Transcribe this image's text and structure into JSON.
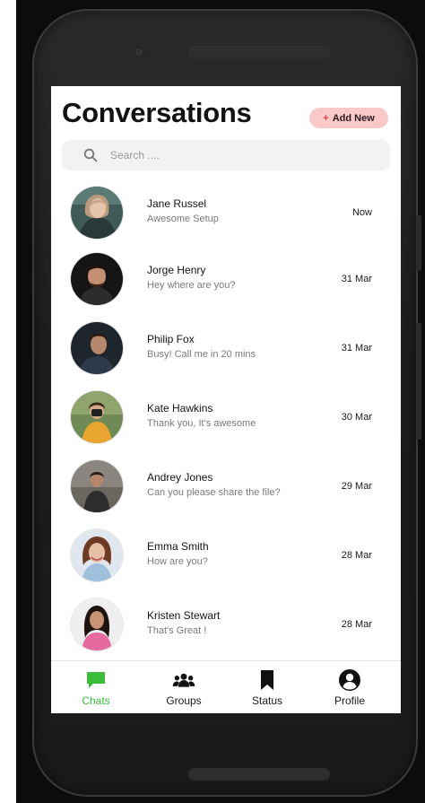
{
  "header": {
    "title": "Conversations",
    "add_button": {
      "icon": "+",
      "label": "Add New"
    }
  },
  "search": {
    "placeholder": "Search ...."
  },
  "conversations": [
    {
      "name": "Jane Russel",
      "message": "Awesome Setup",
      "time": "Now"
    },
    {
      "name": "Jorge Henry",
      "message": "Hey where are you?",
      "time": "31 Mar"
    },
    {
      "name": "Philip Fox",
      "message": "Busy! Call me in 20 mins",
      "time": "31 Mar"
    },
    {
      "name": "Kate Hawkins",
      "message": "Thank you, It's awesome",
      "time": "30 Mar"
    },
    {
      "name": "Andrey Jones",
      "message": "Can you please share the file?",
      "time": "29 Mar"
    },
    {
      "name": "Emma Smith",
      "message": "How are you?",
      "time": "28 Mar"
    },
    {
      "name": "Kristen Stewart",
      "message": "That's Great !",
      "time": "28 Mar"
    }
  ],
  "tabs": [
    {
      "label": "Chats",
      "icon": "chat-bubble-icon",
      "active": true
    },
    {
      "label": "Groups",
      "icon": "groups-icon",
      "active": false
    },
    {
      "label": "Status",
      "icon": "bookmark-icon",
      "active": false
    },
    {
      "label": "Profile",
      "icon": "profile-icon",
      "active": false
    }
  ],
  "colors": {
    "accent": "#3bbd3b",
    "add_button_bg": "#f9c9c9",
    "add_button_plus": "#e04545",
    "search_bg": "#f3f1f1",
    "phone_body": "#1f1f1f"
  }
}
